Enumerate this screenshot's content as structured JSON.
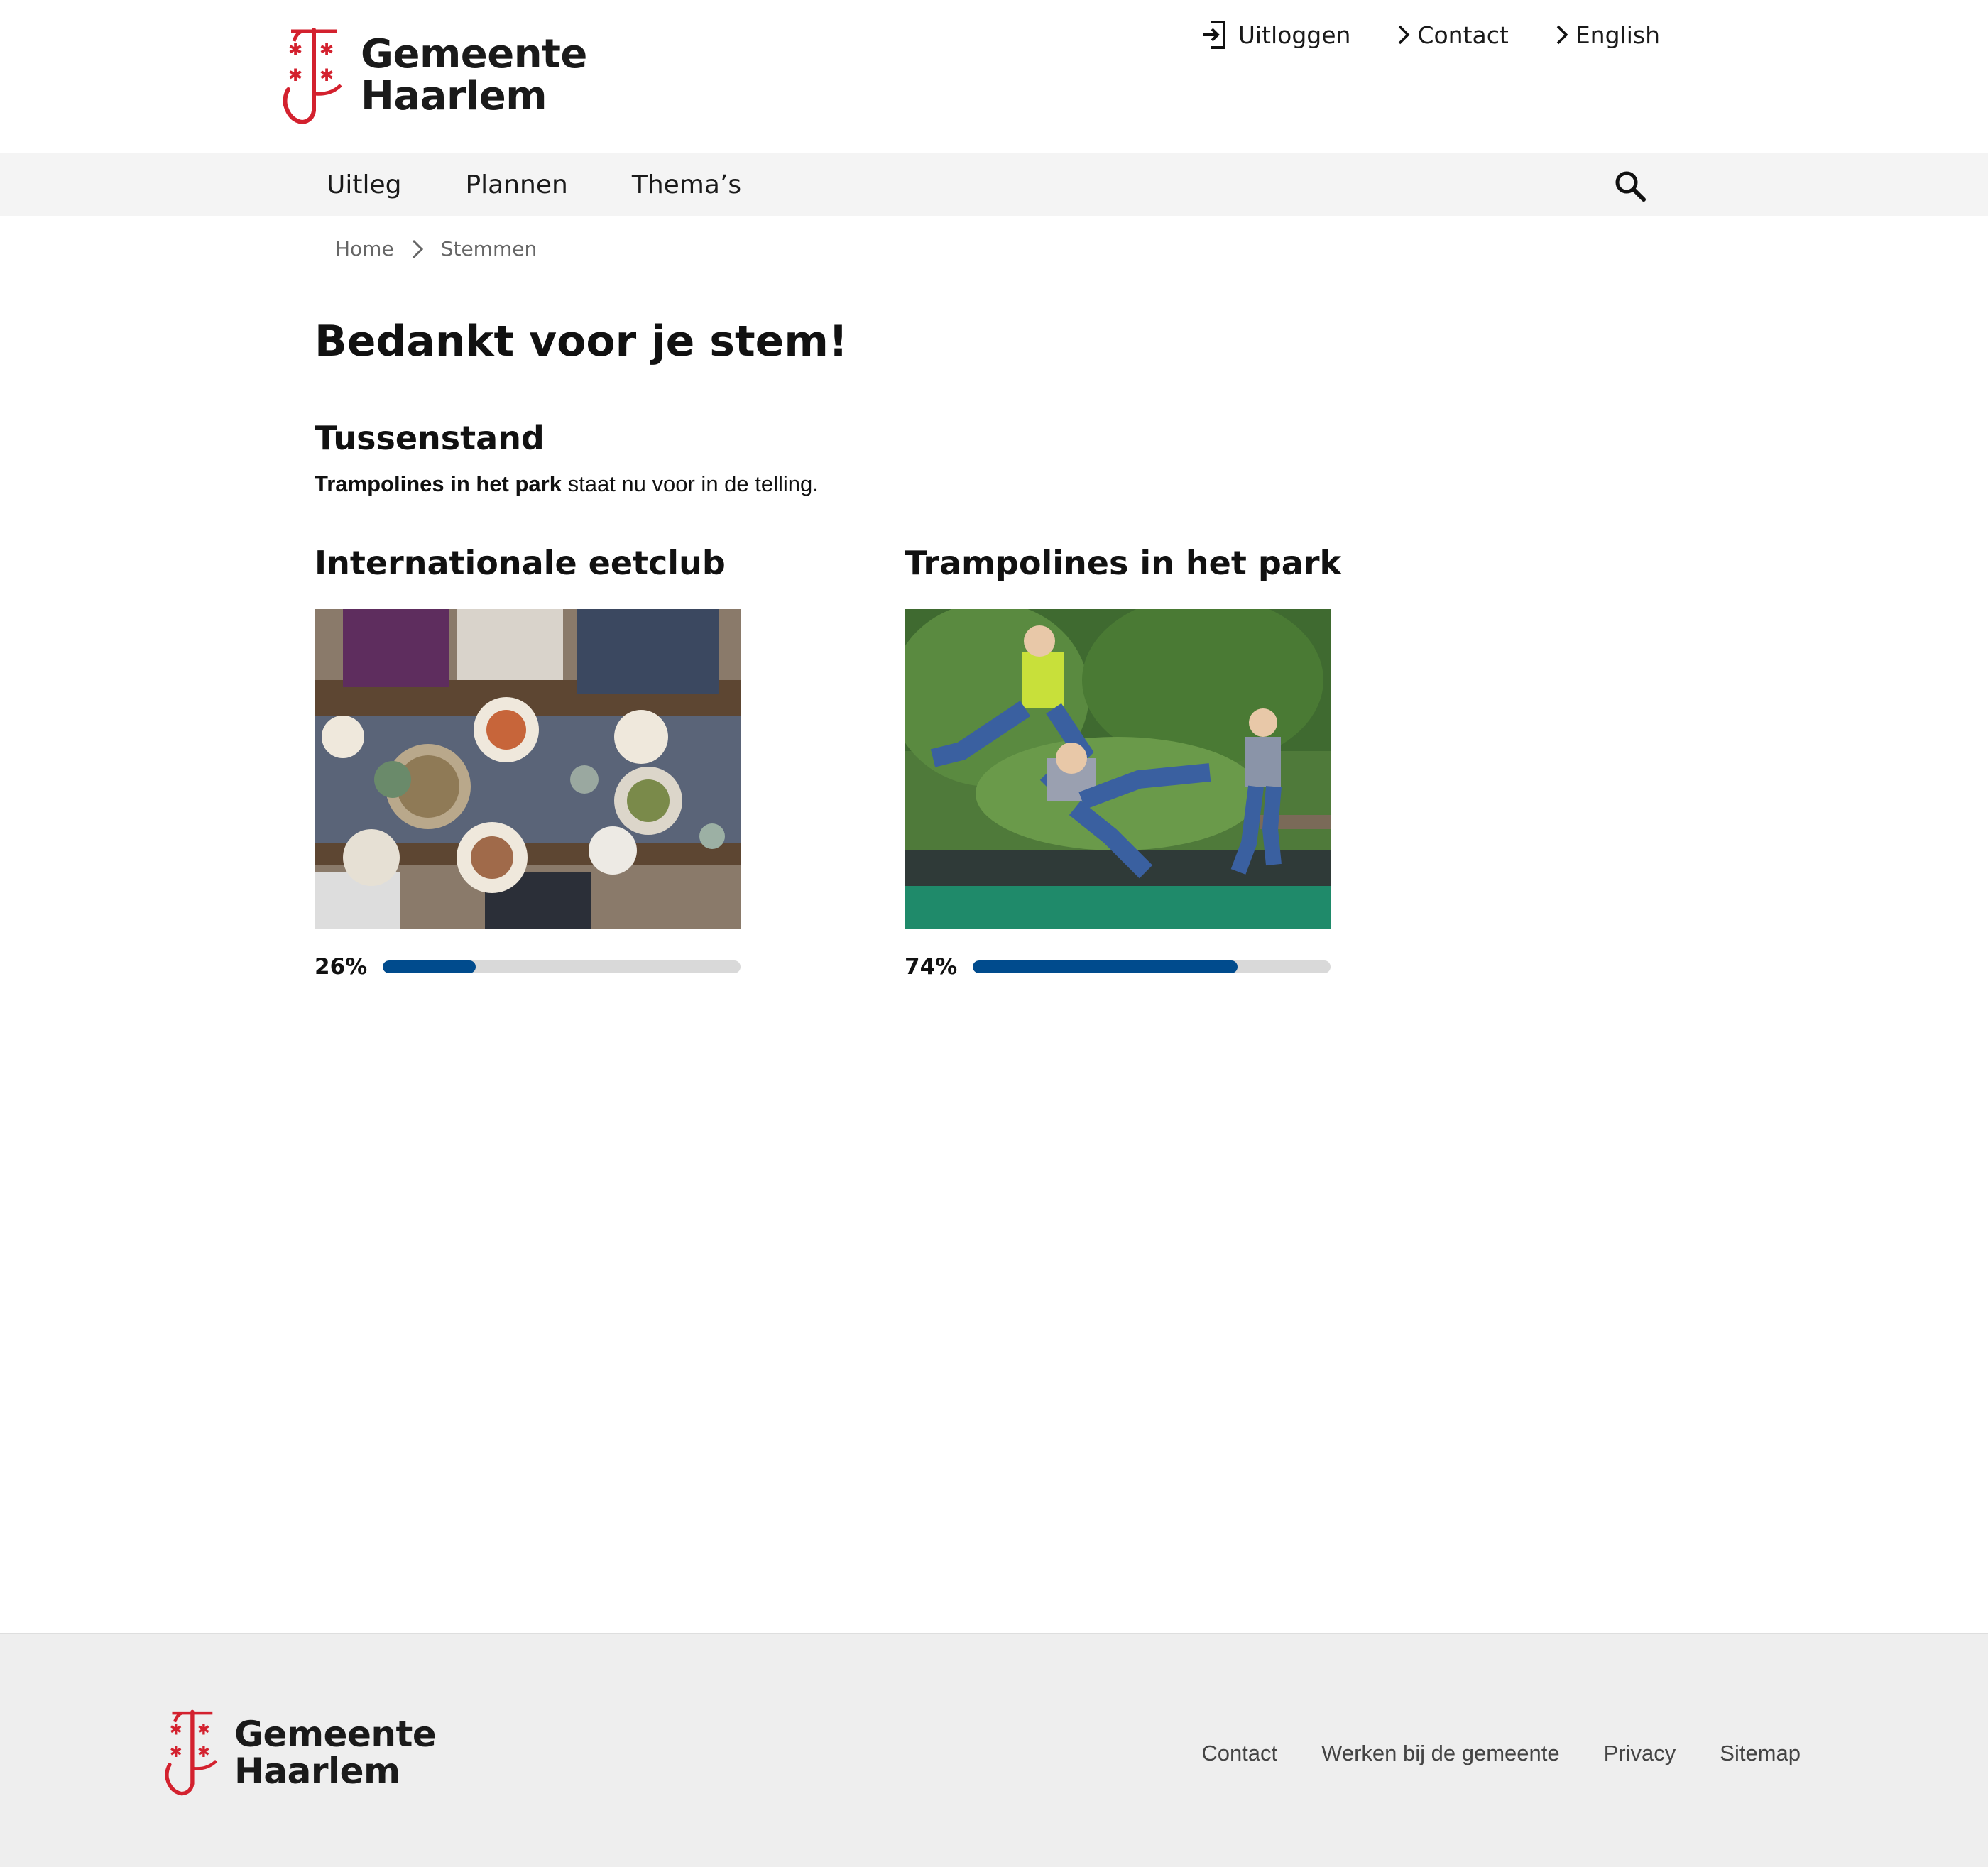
{
  "header": {
    "logo_line1": "Gemeente",
    "logo_line2": "Haarlem",
    "top_links": {
      "logout": "Uitloggen",
      "contact": "Contact",
      "english": "English"
    }
  },
  "nav": {
    "items": [
      "Uitleg",
      "Plannen",
      "Thema’s"
    ],
    "search_icon": "search-icon"
  },
  "breadcrumb": {
    "home": "Home",
    "current": "Stemmen"
  },
  "main": {
    "title": "Bedankt voor je stem!",
    "standings_title": "Tussenstand",
    "leader_name": "Trampolines in het park",
    "leader_suffix": " staat nu voor in de telling.",
    "options": [
      {
        "title": "Internationale eetclub",
        "percent_label": "26%",
        "percent": 26
      },
      {
        "title": "Trampolines in het park",
        "percent_label": "74%",
        "percent": 74
      }
    ]
  },
  "colors": {
    "progress_fill": "#004b8d",
    "progress_track": "#d9d9d9",
    "nav_bg": "#f4f4f4",
    "footer_bg": "#eeeeee",
    "logo_red": "#d3212e"
  },
  "footer": {
    "logo_line1": "Gemeente",
    "logo_line2": "Haarlem",
    "links": [
      "Contact",
      "Werken bij de gemeente",
      "Privacy",
      "Sitemap"
    ]
  }
}
